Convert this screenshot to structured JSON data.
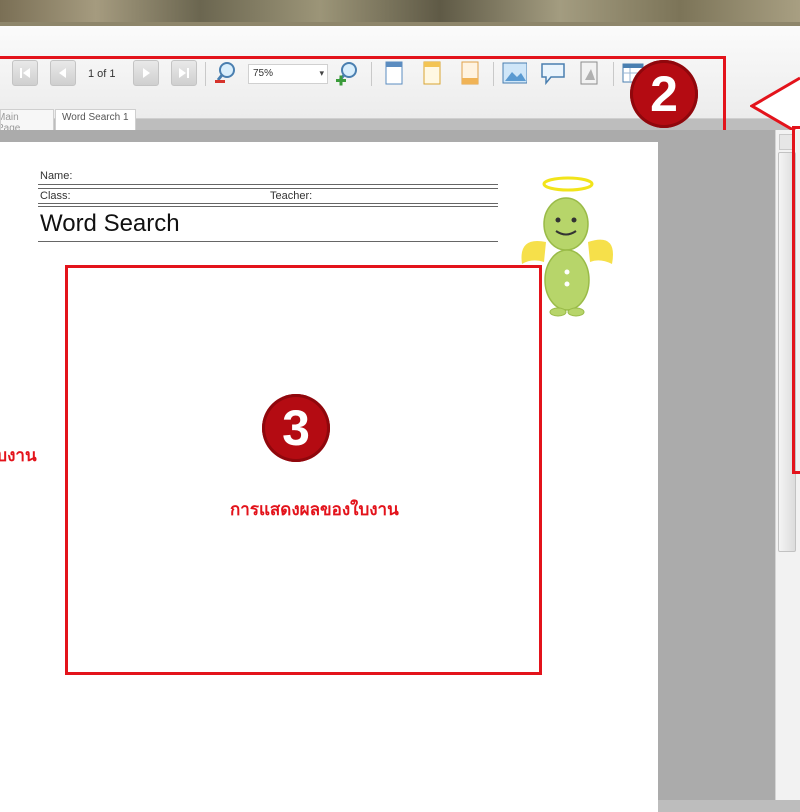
{
  "toolbar": {
    "page_count": "1 of 1",
    "zoom_value": "75%",
    "icons": [
      "first-page-icon",
      "prev-page-icon",
      "next-page-icon",
      "last-page-icon",
      "zoom-out-icon",
      "zoom-in-icon",
      "page-icon",
      "page-icon",
      "page-icon",
      "image-icon",
      "speech-bubble-icon",
      "document-icon",
      "table-icon"
    ]
  },
  "tabs": {
    "main_page": "Main Page",
    "word_search": "Word Search 1"
  },
  "worksheet": {
    "name_label": "Name:",
    "class_label": "Class:",
    "teacher_label": "Teacher:",
    "title": "Word Search"
  },
  "annotations": {
    "marker_2": "2",
    "marker_3": "3",
    "caption_3": "การแสดงผลของใบงาน",
    "caption_left": "ใบงาน"
  },
  "colors": {
    "highlight": "#e3131b",
    "marker": "#b40b12"
  }
}
